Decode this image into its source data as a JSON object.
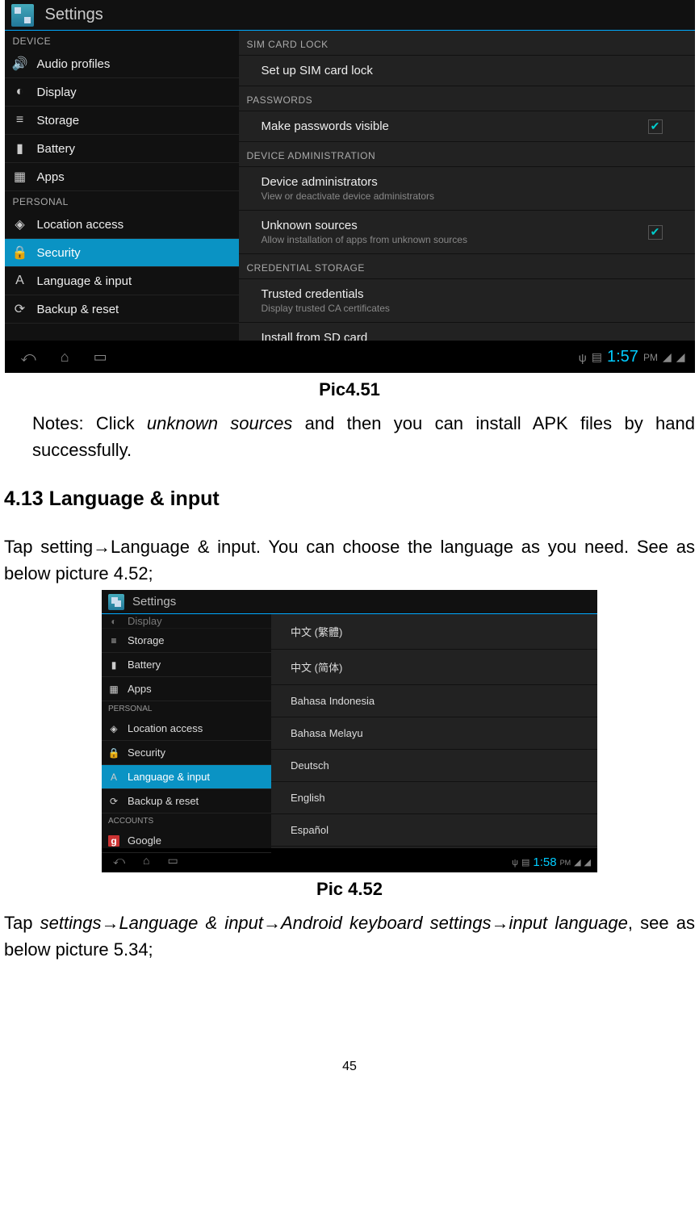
{
  "pic451": {
    "title": "Settings",
    "left": {
      "header": "DEVICE",
      "items": [
        {
          "icon": "🔊",
          "label": "Audio profiles"
        },
        {
          "icon": "◐",
          "label": "Display"
        },
        {
          "icon": "≡",
          "label": "Storage"
        },
        {
          "icon": "▮",
          "label": "Battery"
        },
        {
          "icon": "▦",
          "label": "Apps"
        }
      ],
      "header2": "PERSONAL",
      "items2": [
        {
          "icon": "◈",
          "label": "Location access"
        },
        {
          "icon": "🔒",
          "label": "Security",
          "active": true
        },
        {
          "icon": "A",
          "label": "Language & input"
        },
        {
          "icon": "⟳",
          "label": "Backup & reset"
        }
      ]
    },
    "right": {
      "sections": [
        {
          "header": "SIM CARD LOCK",
          "rows": [
            {
              "title": "Set up SIM card lock"
            }
          ]
        },
        {
          "header": "PASSWORDS",
          "rows": [
            {
              "title": "Make passwords visible",
              "chk": true
            }
          ]
        },
        {
          "header": "DEVICE ADMINISTRATION",
          "rows": [
            {
              "title": "Device administrators",
              "sub": "View or deactivate device administrators"
            },
            {
              "title": "Unknown sources",
              "sub": "Allow installation of apps from unknown sources",
              "chk": true
            }
          ]
        },
        {
          "header": "CREDENTIAL STORAGE",
          "rows": [
            {
              "title": "Trusted credentials",
              "sub": "Display trusted CA certificates"
            },
            {
              "title": "Install from SD card"
            }
          ]
        }
      ]
    },
    "status": {
      "time": "1:57",
      "ampm": "PM"
    }
  },
  "caption451": "Pic4.51",
  "note": {
    "pre": "Notes: Click ",
    "it": "unknown sources",
    "post": " and then you can install APK files by hand successfully."
  },
  "section": "4.13 Language & input",
  "para1": "Tap setting→Language & input. You can choose the language as you need. See as below picture 4.52;",
  "pic452": {
    "title": "Settings",
    "left": {
      "items": [
        {
          "icon": "◐",
          "label": "Display",
          "cut": true
        },
        {
          "icon": "≡",
          "label": "Storage"
        },
        {
          "icon": "▮",
          "label": "Battery"
        },
        {
          "icon": "▦",
          "label": "Apps"
        }
      ],
      "header": "PERSONAL",
      "items2": [
        {
          "icon": "◈",
          "label": "Location access"
        },
        {
          "icon": "🔒",
          "label": "Security"
        },
        {
          "icon": "A",
          "label": "Language & input",
          "active": true
        },
        {
          "icon": "⟳",
          "label": "Backup & reset"
        }
      ],
      "header2": "ACCOUNTS",
      "items3": [
        {
          "icon": "g",
          "label": "Google"
        }
      ]
    },
    "right": {
      "langs": [
        "中文 (繁體)",
        "中文 (简体)",
        "Bahasa Indonesia",
        "Bahasa Melayu",
        "Deutsch",
        "English",
        "Español"
      ]
    },
    "status": {
      "time": "1:58",
      "ampm": "PM"
    }
  },
  "caption452": "Pic 4.52",
  "para2": {
    "pre": "Tap ",
    "it": "settings→Language & input→Android keyboard settings→input language",
    "post": ", see as below picture 5.34;"
  },
  "page": "45"
}
